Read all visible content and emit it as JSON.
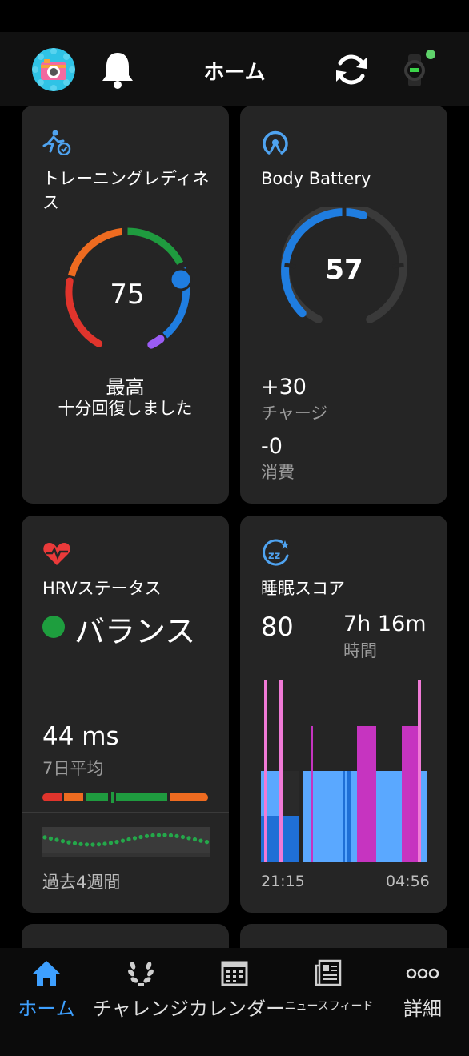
{
  "header": {
    "title": "ホーム"
  },
  "cards": {
    "training": {
      "title": "トレーニングレディネス",
      "value": "75",
      "status": "最高",
      "message": "十分回復しました",
      "score": 75
    },
    "body_battery": {
      "title": "Body Battery",
      "value": "57",
      "charge_value": "+30",
      "charge_label": "チャージ",
      "drain_value": "-0",
      "drain_label": "消費",
      "level": 0.57
    },
    "hrv": {
      "title": "HRVステータス",
      "status": "バランス",
      "value": "44 ms",
      "value_label": "7日平均",
      "period": "過去4週間",
      "status_color": "#1e9e3e"
    },
    "sleep": {
      "title": "睡眠スコア",
      "score": "80",
      "duration": "7h 16m",
      "duration_label": "時間",
      "start_time": "21:15",
      "end_time": "04:56"
    }
  },
  "nav": {
    "items": [
      {
        "label": "ホーム",
        "icon": "home-icon",
        "active": true
      },
      {
        "label": "チャレンジ",
        "icon": "laurel-icon",
        "active": false
      },
      {
        "label": "カレンダー",
        "icon": "calendar-icon",
        "active": false
      },
      {
        "label": "ニュースフィード",
        "icon": "newsfeed-icon",
        "active": false
      },
      {
        "label": "詳細",
        "icon": "more-icon",
        "active": false
      }
    ]
  },
  "colors": {
    "accent": "#3ea0ff",
    "card": "#252525",
    "battery": "#1f7de0",
    "sleep_light": "#5aa8ff",
    "sleep_deep": "#1f6fd6",
    "sleep_rem": "#c634c0",
    "sleep_awake": "#f07ad6"
  }
}
